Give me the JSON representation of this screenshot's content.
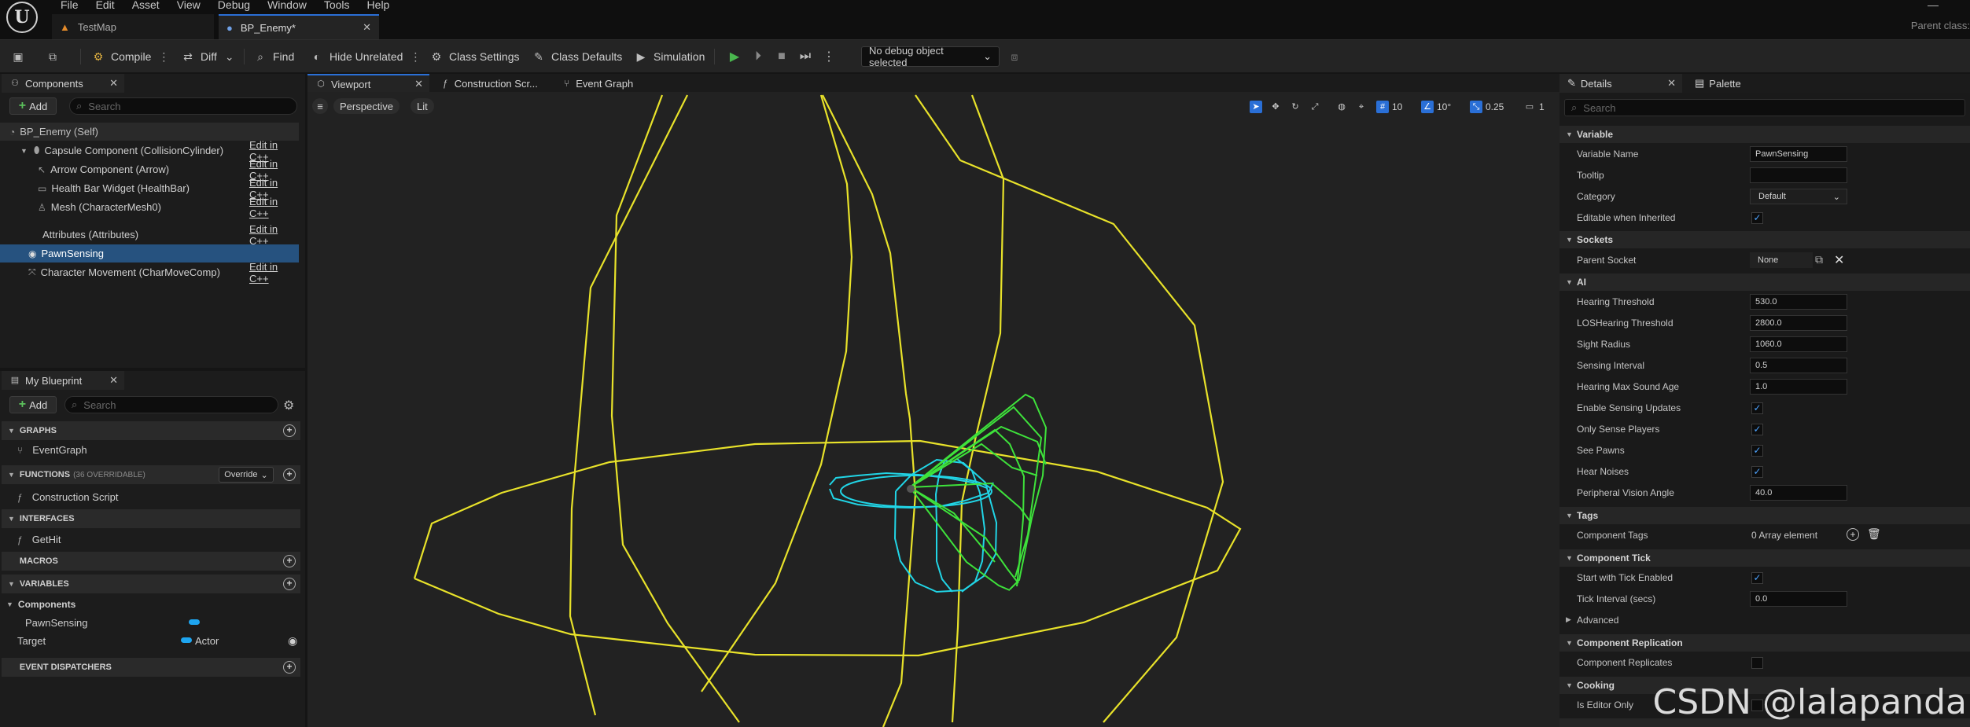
{
  "menu": [
    "File",
    "Edit",
    "Asset",
    "View",
    "Debug",
    "Window",
    "Tools",
    "Help"
  ],
  "window": {
    "minimize": "—",
    "parent_class": "Parent class:"
  },
  "doc_tabs": [
    {
      "label": "TestMap"
    },
    {
      "label": "BP_Enemy*",
      "close": "✕"
    }
  ],
  "toolbar": {
    "compile": "Compile",
    "diff": "Diff",
    "find": "Find",
    "hide_unrelated": "Hide Unrelated",
    "class_settings": "Class Settings",
    "class_defaults": "Class Defaults",
    "simulation": "Simulation",
    "debug_object": "No debug object selected"
  },
  "components_panel": {
    "tab": "Components",
    "close": "✕",
    "add": "Add",
    "search_placeholder": "Search",
    "self": "BP_Enemy (Self)",
    "items": [
      {
        "label": "Capsule Component (CollisionCylinder)",
        "edit": "Edit in C++"
      },
      {
        "label": "Arrow Component (Arrow)",
        "edit": "Edit in C++"
      },
      {
        "label": "Health Bar Widget (HealthBar)",
        "edit": "Edit in C++"
      },
      {
        "label": "Mesh (CharacterMesh0)",
        "edit": "Edit in C++"
      },
      {
        "label": "Attributes (Attributes)",
        "edit": "Edit in C++"
      },
      {
        "label": "PawnSensing",
        "edit": ""
      },
      {
        "label": "Character Movement (CharMoveComp)",
        "edit": "Edit in C++"
      }
    ]
  },
  "my_blueprint": {
    "tab": "My Blueprint",
    "close": "✕",
    "add": "Add",
    "search_placeholder": "Search",
    "graphs": "GRAPHS",
    "event_graph": "EventGraph",
    "functions": "FUNCTIONS",
    "functions_count": "(36 OVERRIDABLE)",
    "override": "Override",
    "construction_script": "Construction Script",
    "interfaces": "INTERFACES",
    "get_hit": "GetHit",
    "macros": "MACROS",
    "variables": "VARIABLES",
    "components_group": "Components",
    "var_pawnsensing": "PawnSensing",
    "var_target": "Target",
    "var_target_type": "Actor",
    "event_dispatchers": "EVENT DISPATCHERS"
  },
  "editor_tabs": {
    "viewport": "Viewport",
    "construction": "Construction Scr...",
    "event_graph": "Event Graph",
    "close": "✕"
  },
  "viewport": {
    "perspective": "Perspective",
    "lit": "Lit",
    "grid_snap": "10",
    "rotation_snap": "10°",
    "scale_snap": "0.25",
    "camera_speed": "1"
  },
  "details": {
    "tab": "Details",
    "palette_tab": "Palette",
    "close": "✕",
    "search_placeholder": "Search",
    "cat_variable": "Variable",
    "variable_name_label": "Variable Name",
    "variable_name": "PawnSensing",
    "tooltip_label": "Tooltip",
    "tooltip": "",
    "category_label": "Category",
    "category": "Default",
    "editable_label": "Editable when Inherited",
    "cat_sockets": "Sockets",
    "parent_socket_label": "Parent Socket",
    "parent_socket": "None",
    "cat_ai": "AI",
    "ai_rows": [
      {
        "label": "Hearing Threshold",
        "value": "530.0"
      },
      {
        "label": "LOSHearing Threshold",
        "value": "2800.0"
      },
      {
        "label": "Sight Radius",
        "value": "1060.0"
      },
      {
        "label": "Sensing Interval",
        "value": "0.5"
      },
      {
        "label": "Hearing Max Sound Age",
        "value": "1.0"
      }
    ],
    "ai_checks": [
      {
        "label": "Enable Sensing Updates",
        "checked": true
      },
      {
        "label": "Only Sense Players",
        "checked": true
      },
      {
        "label": "See Pawns",
        "checked": true
      },
      {
        "label": "Hear Noises",
        "checked": true
      }
    ],
    "peripheral_label": "Peripheral Vision Angle",
    "peripheral_value": "40.0",
    "cat_tags": "Tags",
    "component_tags_label": "Component Tags",
    "component_tags_value": "0 Array element",
    "cat_tick": "Component Tick",
    "start_tick_label": "Start with Tick Enabled",
    "tick_interval_label": "Tick Interval (secs)",
    "tick_interval": "0.0",
    "advanced": "Advanced",
    "cat_replication": "Component Replication",
    "replicates_label": "Component Replicates",
    "cat_cooking": "Cooking",
    "editor_only_label": "Is Editor Only"
  },
  "watermark": "CSDN @lalapanda",
  "colors": {
    "accent_blue": "#26527f",
    "play_green": "#49b64e",
    "sight_sphere": "#e8e22a",
    "hearing_sphere": "#21d5e6",
    "vision_cone": "#3ee23b"
  }
}
